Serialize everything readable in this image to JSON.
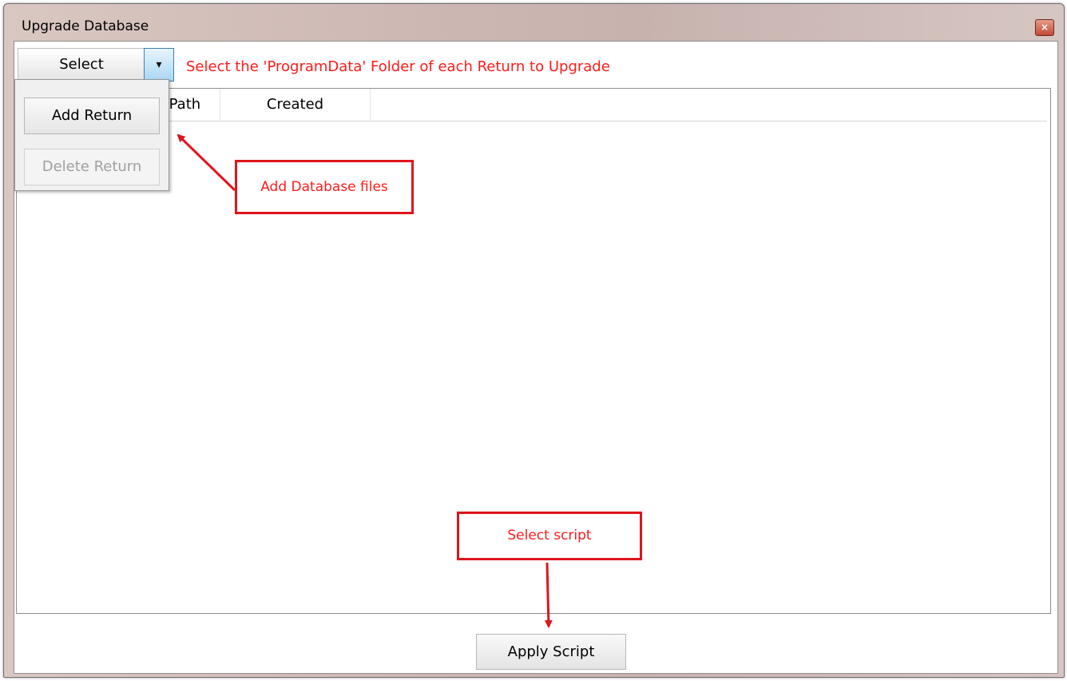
{
  "window": {
    "title": "Upgrade Database",
    "close_glyph": "×"
  },
  "toolbar": {
    "select_label": "Select",
    "dropdown_glyph": "▾",
    "instruction": "Select the 'ProgramData' Folder of each Return to Upgrade"
  },
  "list": {
    "columns": [
      "e Path",
      "Created"
    ]
  },
  "menu": {
    "items": [
      {
        "label": "Add Return",
        "enabled": true
      },
      {
        "label": "Delete Return",
        "enabled": false
      }
    ]
  },
  "annotations": {
    "add_files": "Add Database files",
    "select_script": "Select script",
    "color": "#e0141c"
  },
  "footer": {
    "apply_label": "Apply Script"
  }
}
